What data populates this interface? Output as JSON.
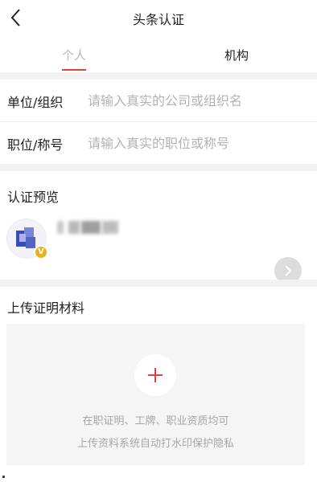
{
  "nav": {
    "title": "头条认证"
  },
  "tabs": {
    "personal": "个人",
    "organization": "机构"
  },
  "form": {
    "company": {
      "label": "单位/组织",
      "placeholder": "请输入真实的公司或组织名"
    },
    "position": {
      "label": "职位/称号",
      "placeholder": "请输入真实的职位或称号"
    }
  },
  "preview": {
    "title": "认证预览",
    "badge": "V"
  },
  "upload": {
    "title": "上传证明材料",
    "hint_line1": "在职证明、工牌、职业资质均可",
    "hint_line2": "上传资料系统自动打水印保护隐私"
  },
  "colors": {
    "accent": "#e0423f",
    "badge": "#e8b21e",
    "divider": "#f2f2f2"
  },
  "icons": {
    "back": "chevron-left-icon",
    "more": "chevron-right-icon",
    "add": "plus-icon"
  }
}
